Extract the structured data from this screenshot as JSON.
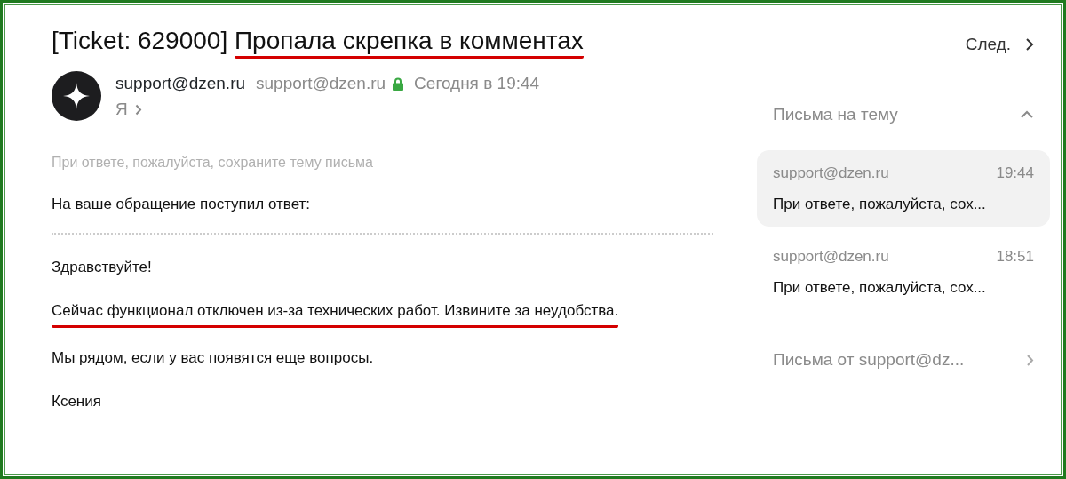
{
  "subject": {
    "prefix": "[Ticket: 629000] ",
    "text": "Пропала скрепка в комментах",
    "underlined": true
  },
  "sender": {
    "name": "support@dzen.ru",
    "address": "support@dzen.ru",
    "secure": true,
    "date": "Сегодня в 19:44",
    "recipient": "Я"
  },
  "body": {
    "hint": "При ответе, пожалуйста, сохраните тему письма",
    "paragraphs": [
      {
        "text": "На ваше обращение поступил ответ:",
        "underlined": false,
        "divider_after": true
      },
      {
        "text": "Здравствуйте!",
        "underlined": false,
        "divider_after": false
      },
      {
        "text": "Сейчас функционал отключен из-за технических работ. Извините за неудобства.",
        "underlined": true,
        "divider_after": false
      },
      {
        "text": "Мы рядом, если у вас появятся еще вопросы.",
        "underlined": false,
        "divider_after": false
      },
      {
        "text": "Ксения",
        "underlined": false,
        "divider_after": false
      }
    ]
  },
  "next_button": {
    "label": "След."
  },
  "thread": {
    "title": "Письма на тему",
    "expanded": true,
    "items": [
      {
        "sender": "support@dzen.ru",
        "time": "19:44",
        "snippet": "При ответе, пожалуйста, сох...",
        "selected": true
      },
      {
        "sender": "support@dzen.ru",
        "time": "18:51",
        "snippet": "При ответе, пожалуйста, сох...",
        "selected": false
      }
    ]
  },
  "from_sender_link": {
    "label": "Письма от support@dz..."
  }
}
